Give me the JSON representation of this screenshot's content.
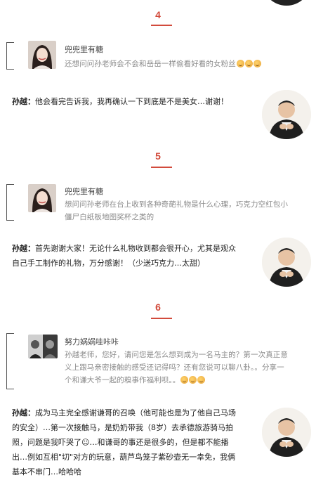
{
  "sections": [
    {
      "number": "4",
      "question": {
        "user": "兜兜里有糖",
        "text": "还想问问孙老师会不会和岳岳一样偷看好看的女粉丝"
      },
      "answer": {
        "name": "孙越：",
        "text": "他会看完告诉我，我再确认一下到底是不是美女…谢谢！"
      }
    },
    {
      "number": "5",
      "question": {
        "user": "兜兜里有糖",
        "text_line1": "想问问孙老师在台上收到各种奇葩礼物是什么心理，巧克力空红包小",
        "text_line2": "僵尸白纸板地图奖杯之类的"
      },
      "answer": {
        "name": "孙越：",
        "text_line1": "首先谢谢大家！无论什么礼物收到都会很开心，尤其是观众",
        "text_line2": "自己手工制作的礼物，万分感谢！（少送巧克力…太甜）"
      }
    },
    {
      "number": "6",
      "question": {
        "user": "努力娲娲哇咔咔",
        "text_line1": "孙越老师，您好，请问您是怎么想到成为一名马主的？第一次真正意",
        "text_line2": "义上跟马亲密接触的感受还记得吗？还有您说可以聊八卦。。分享一",
        "text_line3": "个和谦大爷一起的糗事作福利呗。。"
      },
      "answer": {
        "name": "孙越：",
        "text_line1": "成为马主完全感谢谦哥的召唤（他可能也是为了他自己马场",
        "text_line2": "的安全）…第一次接触马，是奶奶带我（8岁）去承德旅游骑马拍",
        "text_line3": "照，问题是我吓哭了☺…和谦哥的事还是很多的，但是都不能播",
        "text_line4": "出…例如互相\"切\"对方的玩意，葫芦鸟笼子紫砂壶无一幸免，我俩",
        "text_line5": "基本不串门…哈哈哈"
      }
    }
  ]
}
